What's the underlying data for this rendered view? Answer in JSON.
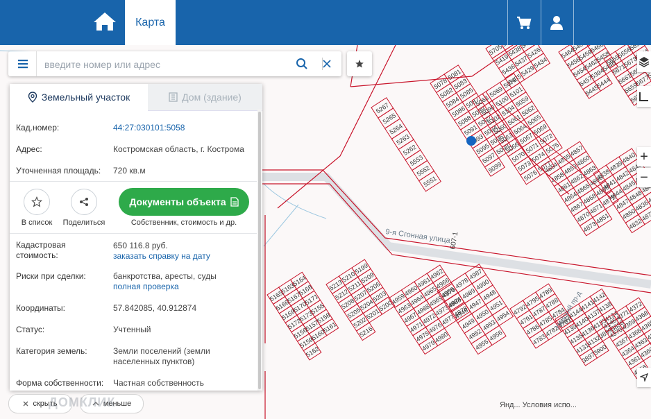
{
  "header": {
    "tab_label": "Карта",
    "icons": [
      "home-icon",
      "cart-icon",
      "user-icon"
    ]
  },
  "search": {
    "placeholder": "введите номер или адрес",
    "value": ""
  },
  "panel": {
    "tabs": [
      {
        "label": "Земельный участок",
        "icon": "pin-icon",
        "active": true
      },
      {
        "label": "Дом (здание)",
        "icon": "building-icon",
        "active": false
      }
    ],
    "cad_number_label": "Кад.номер:",
    "cad_number": "44:27:030101:5058",
    "address_label": "Адрес:",
    "address": "Костромская область, г. Кострома",
    "area_label": "Уточненная площадь:",
    "area": "720 кв.м",
    "add_to_list_label": "В список",
    "share_label": "Поделиться",
    "documents_button": "Документы объекта",
    "documents_caption": "Собственник, стоимость и др.",
    "cadastral_value_label_1": "Кадастровая",
    "cadastral_value_label_2": "стоимость:",
    "cadastral_value": "650 116.8 руб.",
    "cadastral_value_link": "заказать справку на дату",
    "risks_label": "Риски при сделки:",
    "risks_value": "банкротства, аресты, суды",
    "risks_link": "полная проверка",
    "coords_label": "Координаты:",
    "coords_value": "57.842085, 40.912874",
    "status_label": "Статус:",
    "status_value": "Учтенный",
    "category_label": "Категория земель:",
    "category_value_1": "Земли поселений (земли",
    "category_value_2": "населенных пунктов)",
    "ownership_label": "Форма собственности:",
    "ownership_value": "Частная собственность"
  },
  "bottom": {
    "hide_label": "скрыть",
    "less_label": "меньше",
    "watermark": "ДОМКЛИК"
  },
  "map_controls": {
    "zoom_in": "+",
    "zoom_out": "−"
  },
  "map_labels": {
    "street_1": "9-я Сгонная улица",
    "street_2": "Нейский пр-д",
    "street_3": "607-1",
    "attribution": "Янд... Условия испо..."
  },
  "colors": {
    "header_blue": "#1864ab",
    "parcel_red": "#c8142a",
    "button_green": "#2eaa4a",
    "marker_blue": "#1565c0"
  },
  "parcels": [
    [
      "5705",
      "5706",
      "5416",
      "5419",
      "5438",
      "5440",
      "5436",
      "5437",
      "5426",
      "5435",
      "5429",
      "5434"
    ],
    [
      "5464",
      "5466",
      "5468",
      "5456",
      "5459",
      "5460",
      "5454",
      "5462",
      "5458",
      "5457",
      "5394",
      "5446",
      "5445",
      "5444"
    ],
    [
      "5655",
      "5656",
      "5656",
      "5671",
      "5673",
      "5674",
      "5661",
      "5660",
      "5662",
      "5659",
      "5677",
      "5676",
      "5636"
    ],
    [
      "5078",
      "5081",
      "5082",
      "5083",
      "5084",
      "5085",
      "5086",
      "5087",
      "5088",
      "5089",
      "5091",
      "5092",
      "5093",
      "5094",
      "5095",
      "5096",
      "5097",
      "5098",
      "5099"
    ],
    [
      "5068",
      "5069",
      "5079",
      "5090",
      "5100",
      "5101",
      "5102",
      "5104",
      "5059",
      "5060",
      "5061",
      "5062",
      "5063",
      "5064",
      "5065",
      "5066",
      "5067",
      "5069",
      "5070",
      "5071",
      "5072",
      "5073",
      "5074",
      "5075",
      "5076",
      "5077"
    ],
    [
      "5267",
      "5265",
      "5264",
      "5263",
      "5262",
      "5553",
      "5552",
      "5551"
    ],
    [
      "4854",
      "4855",
      "4857",
      "4858",
      "4859",
      "4860",
      "4861",
      "4862",
      "4863",
      "4864",
      "4865",
      "4866",
      "4867",
      "4868",
      "4869",
      "4870",
      "4871",
      "4872",
      "4873",
      "4851"
    ],
    [
      "4838",
      "4839",
      "4840",
      "4841",
      "4842",
      "4843",
      "4844",
      "4845",
      "4846",
      "4847",
      "4848",
      "4849",
      "4850",
      "4836",
      "4835",
      "4832",
      "4878"
    ],
    [
      "5165",
      "5163",
      "5164",
      "5166",
      "5167",
      "5168",
      "5169",
      "5170",
      "5171",
      "5172",
      "5173",
      "5155",
      "5156",
      "5157",
      "5158",
      "5159",
      "5160",
      "5161",
      "5162"
    ],
    [
      "5213",
      "5210",
      "5199",
      "5212",
      "5211",
      "5209",
      "5208",
      "5207",
      "5206",
      "5205",
      "5204",
      "5203",
      "5202",
      "5201",
      "5200",
      "5216"
    ],
    [
      "4959",
      "4960",
      "4961",
      "4962",
      "4963",
      "4964",
      "4965",
      "4966",
      "4967",
      "4968",
      "4969",
      "4970",
      "4971",
      "4972",
      "4973",
      "4974",
      "4975",
      "4976",
      "4977",
      "4978",
      "4979",
      "4980"
    ],
    [
      "4958",
      "4978",
      "4987",
      "4988",
      "4989",
      "4990",
      "4946",
      "4947",
      "4948",
      "4949",
      "4950",
      "4951",
      "4952",
      "4953",
      "4954",
      "4955",
      "4956"
    ],
    [
      "4792",
      "4795",
      "4789",
      "4791",
      "4787",
      "4788",
      "4786",
      "4785",
      "4784",
      "4783",
      "4782",
      "4781"
    ],
    [
      "4143",
      "4144",
      "4141",
      "4142",
      "4139",
      "4140",
      "4137",
      "4138",
      "4135",
      "4136",
      "4133",
      "4134",
      "4131",
      "4132",
      "3899",
      "3898",
      "3897",
      "3900"
    ],
    [
      "4146",
      "4371",
      "4372",
      "4370",
      "4369",
      "4368",
      "4367",
      "4366",
      "4365",
      "4364",
      "4363",
      "4362",
      "4361",
      "4360",
      "4359",
      "4356"
    ]
  ]
}
